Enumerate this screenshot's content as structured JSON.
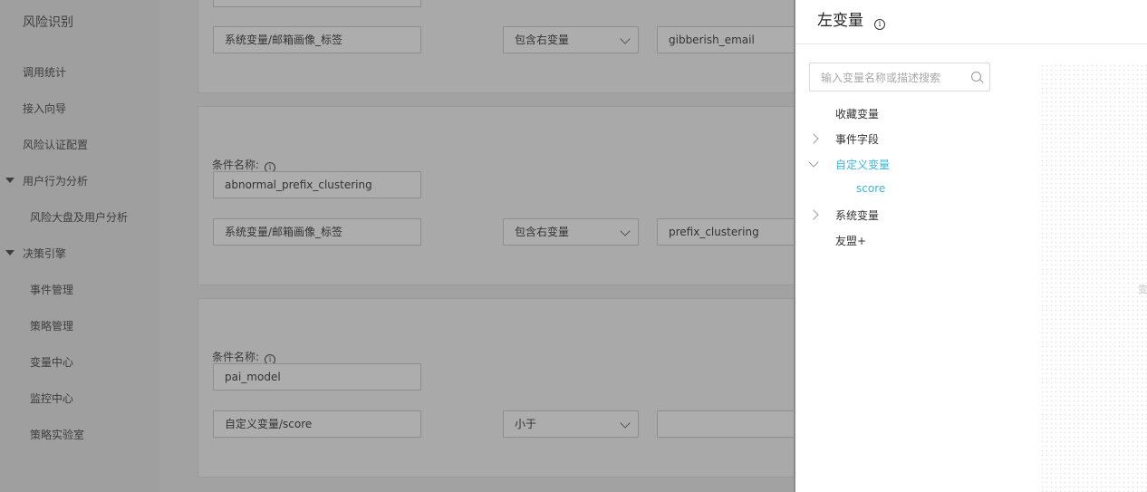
{
  "sidebar": {
    "brand": "风险识别",
    "items": [
      {
        "label": "调用统计"
      },
      {
        "label": "接入向导"
      },
      {
        "label": "风险认证配置"
      },
      {
        "label": "用户行为分析"
      },
      {
        "label": "风险大盘及用户分析"
      },
      {
        "label": "决策引擎"
      },
      {
        "label": "事件管理"
      },
      {
        "label": "策略管理"
      },
      {
        "label": "变量中心"
      },
      {
        "label": "监控中心"
      },
      {
        "label": "策略实验室"
      }
    ]
  },
  "main": {
    "conditions": [
      {
        "left": "系统变量/邮箱画像_标签",
        "operator": "包含右变量",
        "right": "gibberish_email"
      },
      {
        "name_label": "条件名称:",
        "name": "abnormal_prefix_clustering",
        "left": "系统变量/邮箱画像_标签",
        "operator": "包含右变量",
        "right": "prefix_clustering"
      },
      {
        "name_label": "条件名称:",
        "name": "pai_model",
        "left": "自定义变量/score",
        "operator": "小于",
        "right": ""
      }
    ]
  },
  "drawer": {
    "title": "左变量",
    "search_placeholder": "输入变量名称或描述搜索",
    "tree": [
      {
        "label": "收藏变量"
      },
      {
        "label": "事件字段"
      },
      {
        "label": "自定义变量"
      },
      {
        "label": "score"
      },
      {
        "label": "系统变量"
      },
      {
        "label": "友盟+"
      }
    ],
    "edge_text": "变",
    "active_color": "#3ab8d9"
  }
}
